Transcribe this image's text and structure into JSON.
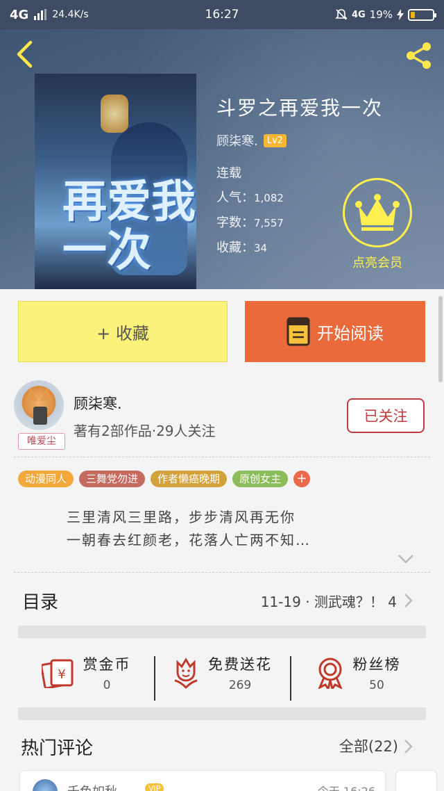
{
  "status_bar": {
    "network": "4G",
    "speed": "24.4K/s",
    "time": "16:27",
    "network2": "4G",
    "battery_pct": "19%",
    "battery_level": 0.19
  },
  "book": {
    "title": "斗罗之再爱我一次",
    "cover_text": "再爱我一次",
    "author": "顾柒寒.",
    "author_level": "Lv2",
    "status": "连载",
    "popularity_label": "人气：",
    "popularity": "1,082",
    "words_label": "字数：",
    "words": "7,557",
    "favorites_label": "收藏：",
    "favorites": "34",
    "vip_label": "点亮会员"
  },
  "actions": {
    "collect_label": "+ 收藏",
    "read_label": "开始阅读"
  },
  "author_card": {
    "avatar_tag": "唯爱尘",
    "name": "顾柒寒.",
    "stats": "著有2部作品·29人关注",
    "follow_label": "已关注"
  },
  "tags": [
    {
      "label": "动漫同人",
      "color": "#f3a83b"
    },
    {
      "label": "三舞党勿进",
      "color": "#c46a5e"
    },
    {
      "label": "作者懒癌晚期",
      "color": "#d4a23c"
    },
    {
      "label": "原创女主",
      "color": "#8cbd5b"
    }
  ],
  "description": {
    "line1": "三里清风三里路，步步清风再无你",
    "line2": "一朝春去红颜老，花落人亡两不知…"
  },
  "catalog": {
    "title": "目录",
    "latest": "11-19 · 测武魂？！ 4"
  },
  "stats": [
    {
      "label": "赏金币",
      "value": "0",
      "icon": "red-envelope-icon"
    },
    {
      "label": "免费送花",
      "value": "269",
      "icon": "flower-icon"
    },
    {
      "label": "粉丝榜",
      "value": "50",
      "icon": "ribbon-medal-icon"
    }
  ],
  "comments": {
    "title": "热门评论",
    "all_label": "全部(22)",
    "first": {
      "user": "千色如秋",
      "vip": "VIP",
      "time": "今天 16:26"
    }
  },
  "colors": {
    "accent_orange": "#ea6a3c",
    "collect_yellow": "#fbf27b",
    "follow_red": "#c0393b",
    "vip_yellow": "#ffef4f"
  }
}
